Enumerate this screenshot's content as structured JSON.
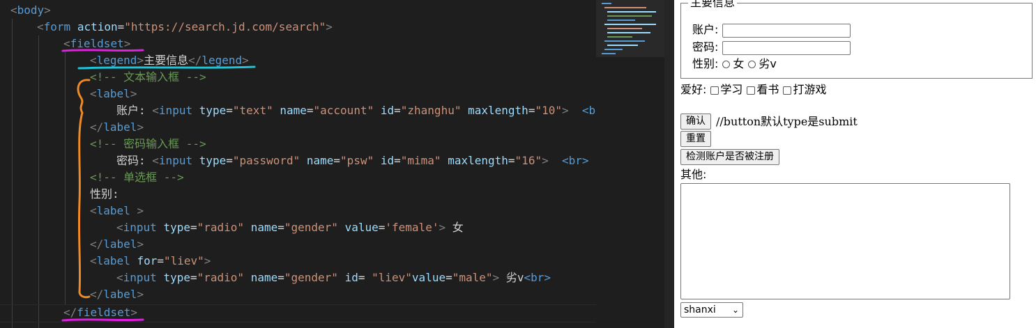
{
  "code": {
    "l1": {
      "tag": "body"
    },
    "l2": {
      "tag": "form",
      "attr": "action",
      "val": "\"https://search.jd.com/search\""
    },
    "l3": {
      "tag": "fieldset"
    },
    "l4": {
      "tag": "legend",
      "text": "主要信息"
    },
    "l5": {
      "comment": "<!-- 文本输入框 -->"
    },
    "l6": {
      "tag": "label"
    },
    "l7": {
      "label": "账户:",
      "tag": "input",
      "a1": "type",
      "v1": "\"text\"",
      "a2": "name",
      "v2": "\"account\"",
      "a3": "id",
      "v3": "\"zhanghu\"",
      "a4": "maxlength",
      "v4": "\"10\"",
      "tail": "<b"
    },
    "l8": {
      "tag": "label"
    },
    "l9": {
      "comment": "<!-- 密码输入框 -->"
    },
    "l10": {
      "label": "密码:",
      "tag": "input",
      "a1": "type",
      "v1": "\"password\"",
      "a2": "name",
      "v2": "\"psw\"",
      "a3": "id",
      "v3": "\"mima\"",
      "a4": "maxlength",
      "v4": "\"16\"",
      "tail": "<br>"
    },
    "l11": {
      "comment": "<!-- 单选框 -->"
    },
    "l12": {
      "text": "性别:"
    },
    "l13": {
      "tag": "label"
    },
    "l14": {
      "tag": "input",
      "a1": "type",
      "v1": "\"radio\"",
      "a2": "name",
      "v2": "\"gender\"",
      "a3": "value",
      "v3": "'female'",
      "text": "女"
    },
    "l15": {
      "tag": "label"
    },
    "l16": {
      "tag": "label",
      "attr": "for",
      "val": "\"liev\""
    },
    "l17": {
      "tag": "input",
      "a1": "type",
      "v1": "\"radio\"",
      "a2": "name",
      "v2": "\"gender\"",
      "a3": "id",
      "v3": "\"liev\"",
      "a4": "value",
      "v4": "\"male\"",
      "text": "劣v",
      "tail": "<br>"
    },
    "l18": {
      "tag": "label"
    },
    "l19": {
      "tag": "fieldset"
    }
  },
  "preview": {
    "legend": "主要信息",
    "account_label": "账户:",
    "password_label": "密码:",
    "gender_label": "性别:",
    "gender_female": "女",
    "gender_male": "劣v",
    "hobby_label": "爱好:",
    "hobby_study": "学习",
    "hobby_read": "看书",
    "hobby_game": "打游戏",
    "confirm_button": "确认",
    "confirm_note": "//button默认type是submit",
    "reset_button": "重置",
    "check_button": "检测账户是否被注册",
    "other_label": "其他:",
    "select_value": "shanxi"
  },
  "colors": {
    "tag": "#569cd6",
    "attr": "#9cdcfe",
    "string": "#ce9178",
    "comment": "#6a9955",
    "annotation_magenta": "#e11fe1",
    "annotation_cyan": "#1fc3d6",
    "annotation_orange": "#f08a24"
  }
}
